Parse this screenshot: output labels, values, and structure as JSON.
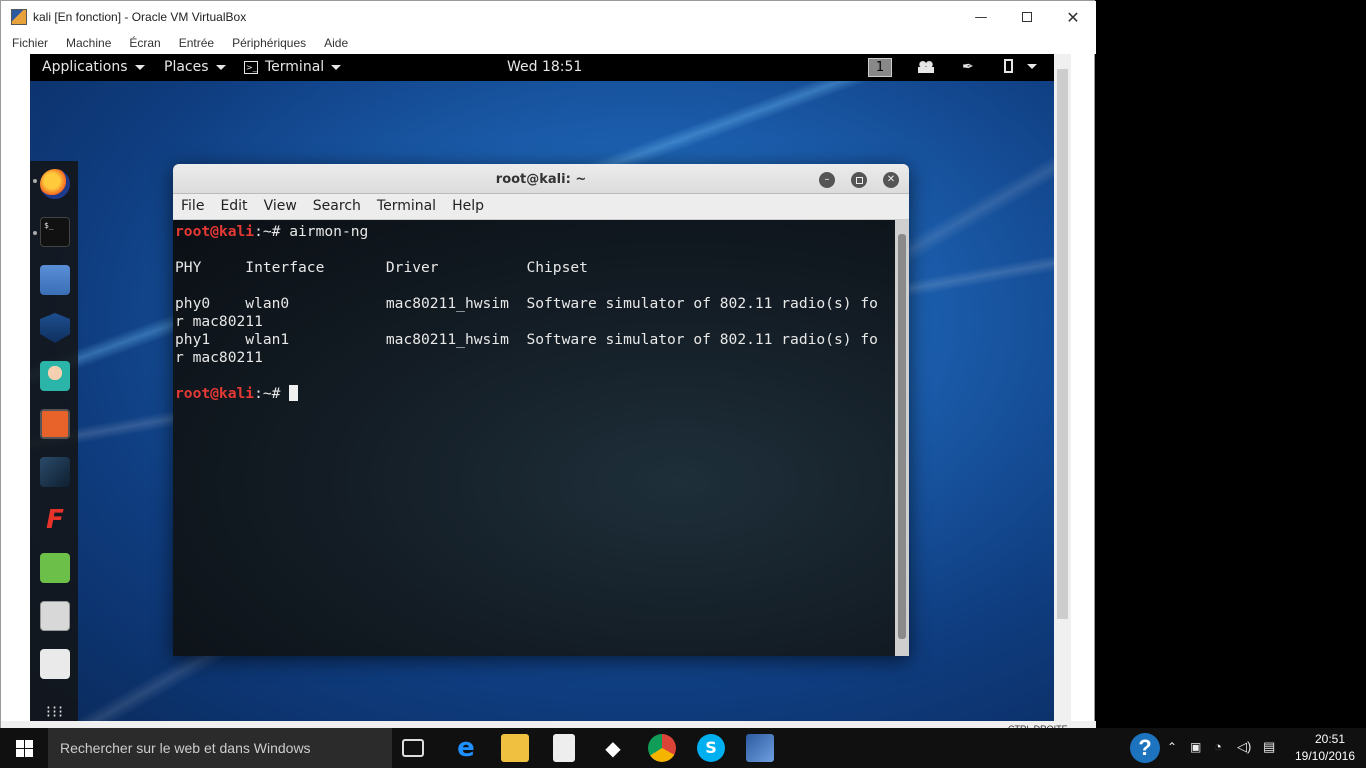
{
  "vbox": {
    "title": "kali [En fonction] - Oracle VM VirtualBox",
    "menu": [
      "Fichier",
      "Machine",
      "Écran",
      "Entrée",
      "Périphériques",
      "Aide"
    ],
    "host_key_label": "CTRL DROITE"
  },
  "kali_panel": {
    "applications": "Applications",
    "places": "Places",
    "terminal": "Terminal",
    "clock": "Wed 18:51",
    "workspace": "1"
  },
  "dock": {
    "items": [
      "firefox-icon",
      "terminal-icon",
      "files-icon",
      "metasploit-icon",
      "armitage-icon",
      "burpsuite-icon",
      "beef-icon",
      "faraday-icon",
      "leafpad-icon",
      "cherrytree-icon",
      "settings-icon",
      "show-apps-icon"
    ]
  },
  "terminal": {
    "title": "root@kali: ~",
    "menu": [
      "File",
      "Edit",
      "View",
      "Search",
      "Terminal",
      "Help"
    ],
    "prompt_user": "root@kali",
    "prompt_rest": ":~# ",
    "command": "airmon-ng",
    "header": "PHY     Interface       Driver          Chipset",
    "row1": "phy0    wlan0           mac80211_hwsim  Software simulator of 802.11 radio(s) fo",
    "row1_wrap": "r mac80211",
    "row2": "phy1    wlan1           mac80211_hwsim  Software simulator of 802.11 radio(s) fo",
    "row2_wrap": "r mac80211"
  },
  "taskbar": {
    "search_placeholder": "Rechercher sur le web et dans Windows",
    "time": "20:51",
    "date": "19/10/2016"
  },
  "colors": {
    "prompt_red": "#e53935",
    "kali_panel_bg": "#000000",
    "taskbar_bg": "#101010"
  }
}
